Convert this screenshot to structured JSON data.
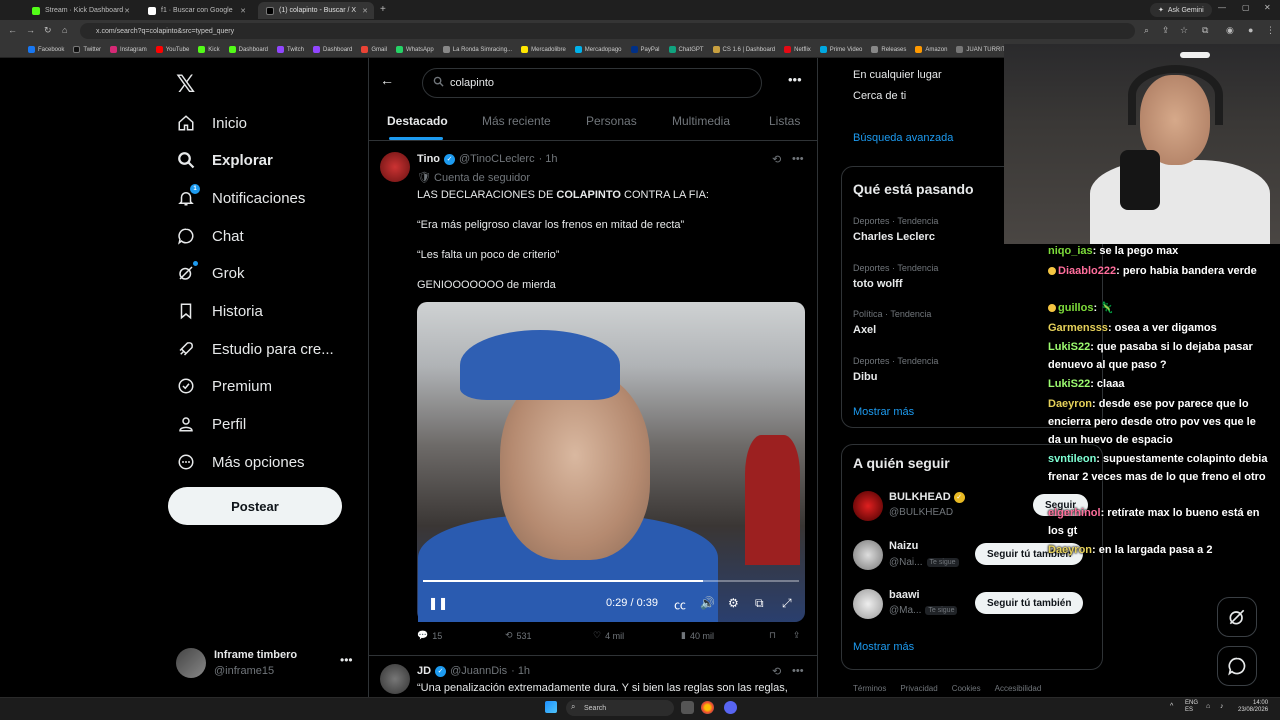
{
  "browser": {
    "tabs": [
      {
        "label": "Stream · Kick Dashboard",
        "color": "#53fc18"
      },
      {
        "label": "f1 · Buscar con Google",
        "color": "#ffffff"
      },
      {
        "label": "(1) colapinto - Buscar / X",
        "color": "#000000"
      }
    ],
    "ask_gemini": "Ask Gemini",
    "url": "x.com/search?q=colapinto&src=typed_query",
    "bookmarks": [
      "Facebook",
      "Twitter",
      "Instagram",
      "YouTube",
      "Kick",
      "Dashboard",
      "Twitch",
      "Dashboard",
      "Gmail",
      "WhatsApp",
      "La Ronda Simracing...",
      "Mercadolibre",
      "Mercadopago",
      "PayPal",
      "ChatGPT",
      "CS 1.6 | Dashboard",
      "Netflix",
      "Prime Video",
      "Releases",
      "Amazon",
      "JUAN TURRITO"
    ]
  },
  "nav": {
    "items": [
      {
        "label": "Inicio",
        "icon": "home-icon"
      },
      {
        "label": "Explorar",
        "icon": "search-icon"
      },
      {
        "label": "Notificaciones",
        "icon": "bell-icon",
        "badge": "1"
      },
      {
        "label": "Chat",
        "icon": "chat-icon"
      },
      {
        "label": "Grok",
        "icon": "grok-icon"
      },
      {
        "label": "Historia",
        "icon": "bookmark-icon"
      },
      {
        "label": "Estudio para cre...",
        "icon": "rocket-icon"
      },
      {
        "label": "Premium",
        "icon": "verified-icon"
      },
      {
        "label": "Perfil",
        "icon": "person-icon"
      },
      {
        "label": "Más opciones",
        "icon": "more-circle-icon"
      }
    ],
    "post_label": "Postear",
    "account": {
      "name": "Inframe timbero",
      "handle": "@inframe15"
    }
  },
  "search": {
    "query": "colapinto",
    "tabs": [
      "Destacado",
      "Más reciente",
      "Personas",
      "Multimedia",
      "Listas"
    ]
  },
  "tweet1": {
    "name": "Tino",
    "handle": "@TinoCLeclerc",
    "time": "· 1h",
    "social": "Cuenta de seguidor",
    "line1_pre": "LAS DECLARACIONES DE ",
    "line1_bold": "COLAPINTO",
    "line1_post": " CONTRA LA FIA:",
    "line2": "“Era más peligroso clavar los frenos en mitad de recta”",
    "line3": "“Les falta un poco de criterio”",
    "line4": "GENIOOOOOOO de mierda",
    "video": {
      "time": "0:29 / 0:39",
      "progress": 0.744
    },
    "stats": {
      "replies": "15",
      "reposts": "531",
      "likes": "4 mil",
      "views": "40 mil"
    }
  },
  "tweet2": {
    "name": "JD",
    "handle": "@JuannDis",
    "time": "· 1h",
    "text": "“Una penalización extremadamente dura. Y si bien las reglas son las reglas,"
  },
  "right": {
    "location_any": "En cualquier lugar",
    "location_near": "Cerca de ti",
    "advanced": "Búsqueda avanzada",
    "trends_title": "Qué está pasando",
    "trends": [
      {
        "meta": "Deportes · Tendencia",
        "name": "Charles Leclerc"
      },
      {
        "meta": "Deportes · Tendencia",
        "name": "toto wolff"
      },
      {
        "meta": "Política · Tendencia",
        "name": "Axel"
      },
      {
        "meta": "Deportes · Tendencia",
        "name": "Dibu"
      }
    ],
    "trends_more": "Mostrar más",
    "who_title": "A quién seguir",
    "who": [
      {
        "name": "BULKHEAD",
        "handle": "@BULKHEAD",
        "button": "Seguir",
        "follows_you": ""
      },
      {
        "name": "Naizu",
        "handle": "@Nai...",
        "button": "Seguir tú también",
        "follows_you": "Te sigue"
      },
      {
        "name": "baawi",
        "handle": "@Ma...",
        "button": "Seguir tú también",
        "follows_you": "Te sigue"
      }
    ],
    "who_more": "Mostrar más",
    "footer": [
      "Términos",
      "Privacidad",
      "Cookies",
      "Accesibilidad"
    ]
  },
  "chat": [
    {
      "user": "niqo_ias",
      "msg": ": se la pego max",
      "color": "u-green"
    },
    {
      "user": "Diaablo222",
      "msg": ": pero habia bandera verde",
      "color": "u-pink"
    },
    {
      "user": "guillos",
      "msg": ": 🦎",
      "color": "u-green"
    },
    {
      "user": "Garmensss",
      "msg": ": osea a ver digamos",
      "color": "u-yellow"
    },
    {
      "user": "LukiS22",
      "msg": ": que pasaba si lo dejaba pasar denuevo al que paso ?",
      "color": "u-light"
    },
    {
      "user": "LukiS22",
      "msg": ": claaa",
      "color": "u-light"
    },
    {
      "user": "Daeyron",
      "msg": ": desde ese pov parece que lo encierra pero desde otro pov ves que le da un huevo de espacio",
      "color": "u-yellow"
    },
    {
      "user": "svntileon",
      "msg": ": supuestamente colapinto debia frenar 2 veces mas de lo que freno el otro",
      "color": "u-cyan"
    },
    {
      "user": "elgerhinol",
      "msg": ": retírate max lo bueno está en los gt",
      "color": "u-pink"
    },
    {
      "user": "Daeyron",
      "msg": ": en la largada pasa a 2",
      "color": "u-yellow"
    }
  ],
  "taskbar": {
    "search": "Search",
    "lang": "ENG",
    "lang2": "ES",
    "time": "14:00",
    "date": "23/08/2026"
  }
}
